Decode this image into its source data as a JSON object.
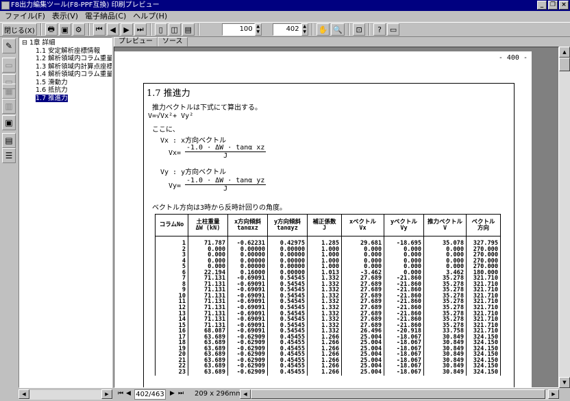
{
  "window": {
    "title": "F8出力編集ツール(F8-PPF互換) 印刷プレビュー"
  },
  "menu": [
    "ファイル(F)",
    "表示(V)",
    "電子納品(C)",
    "ヘルプ(H)"
  ],
  "toolbar": {
    "close_label": "閉じる(X)",
    "zoom_value": "100",
    "page_value": "402"
  },
  "tree": {
    "root": "1章 詳細",
    "items": [
      "1.1 安定解析座標情報",
      "1.2 解析領域内コラム重量",
      "1.3 解析領域内計算点座標",
      "1.4 解析領域内コラム重量",
      "1.5 滑動力",
      "1.6 抵抗力",
      "1.7 推進力"
    ],
    "selected_index": 6
  },
  "tabs": [
    "プレビュー",
    "ソース"
  ],
  "page": {
    "page_number": "- 400 -",
    "section_title": "1.7 推進力",
    "intro": "推力ベクトルは下式にて算出する。",
    "formula_v": "V=√Vx²+ Vy²",
    "here": "ここに、",
    "vx_label": "Vx : x方向ベクトル",
    "vx_eq": "Vx=",
    "vx_num": "-1.0 · ΔW · tanα xz",
    "vx_den": "J",
    "vy_label": "Vy : y方向ベクトル",
    "vy_eq": "Vy=",
    "vy_num": "-1.0 · ΔW · tanα yz",
    "vy_den": "J",
    "direction_note": "ベクトル方向は3時から反時計回りの角度。",
    "table": {
      "headers": [
        [
          "コラムNo",
          ""
        ],
        [
          "土柱重量",
          "ΔW (kN)"
        ],
        [
          "x方向傾斜",
          "tanαxz"
        ],
        [
          "y方向傾斜",
          "tanαyz"
        ],
        [
          "補正係数",
          "J"
        ],
        [
          "xベクトル",
          "Vx"
        ],
        [
          "yベクトル",
          "Vy"
        ],
        [
          "推力ベクトル",
          "V"
        ],
        [
          "ベクトル",
          "方向"
        ]
      ],
      "rows": [
        [
          "1",
          "71.787",
          "-0.62231",
          "0.42975",
          "1.285",
          "29.681",
          "-18.695",
          "35.078",
          "327.795"
        ],
        [
          "2",
          "0.000",
          "0.00000",
          "0.00000",
          "1.000",
          "0.000",
          "0.000",
          "0.000",
          "270.000"
        ],
        [
          "3",
          "0.000",
          "0.00000",
          "0.00000",
          "1.000",
          "0.000",
          "0.000",
          "0.000",
          "270.000"
        ],
        [
          "4",
          "0.000",
          "0.00000",
          "0.00000",
          "1.000",
          "0.000",
          "0.000",
          "0.000",
          "270.000"
        ],
        [
          "5",
          "0.000",
          "0.00000",
          "0.00000",
          "1.000",
          "0.000",
          "0.000",
          "0.000",
          "270.000"
        ],
        [
          "6",
          "22.194",
          "0.16000",
          "0.00000",
          "1.013",
          "-3.462",
          "0.000",
          "3.462",
          "180.000"
        ],
        [
          "7",
          "71.131",
          "-0.69091",
          "0.54545",
          "1.332",
          "27.689",
          "-21.860",
          "35.278",
          "321.710"
        ],
        [
          "8",
          "71.131",
          "-0.69091",
          "0.54545",
          "1.332",
          "27.689",
          "-21.860",
          "35.278",
          "321.710"
        ],
        [
          "9",
          "71.131",
          "-0.69091",
          "0.54545",
          "1.332",
          "27.689",
          "-21.860",
          "35.278",
          "321.710"
        ],
        [
          "10",
          "71.131",
          "-0.69091",
          "0.54545",
          "1.332",
          "27.689",
          "-21.860",
          "35.278",
          "321.710"
        ],
        [
          "11",
          "71.131",
          "-0.69091",
          "0.54545",
          "1.332",
          "27.689",
          "-21.860",
          "35.278",
          "321.710"
        ],
        [
          "12",
          "71.131",
          "-0.69091",
          "0.54545",
          "1.332",
          "27.689",
          "-21.860",
          "35.278",
          "321.710"
        ],
        [
          "13",
          "71.131",
          "-0.69091",
          "0.54545",
          "1.332",
          "27.689",
          "-21.860",
          "35.278",
          "321.710"
        ],
        [
          "14",
          "71.131",
          "-0.69091",
          "0.54545",
          "1.332",
          "27.689",
          "-21.860",
          "35.278",
          "321.710"
        ],
        [
          "15",
          "71.131",
          "-0.69091",
          "0.54545",
          "1.332",
          "27.689",
          "-21.860",
          "35.278",
          "321.710"
        ],
        [
          "16",
          "68.087",
          "-0.69091",
          "0.54545",
          "1.332",
          "26.496",
          "-20.918",
          "33.758",
          "321.710"
        ],
        [
          "17",
          "63.689",
          "-0.62909",
          "0.45455",
          "1.266",
          "25.004",
          "-18.067",
          "30.849",
          "324.150"
        ],
        [
          "18",
          "63.689",
          "-0.62909",
          "0.45455",
          "1.266",
          "25.004",
          "-18.067",
          "30.849",
          "324.150"
        ],
        [
          "19",
          "63.689",
          "-0.62909",
          "0.45455",
          "1.266",
          "25.004",
          "-18.067",
          "30.849",
          "324.150"
        ],
        [
          "20",
          "63.689",
          "-0.62909",
          "0.45455",
          "1.266",
          "25.004",
          "-18.067",
          "30.849",
          "324.150"
        ],
        [
          "21",
          "63.689",
          "-0.62909",
          "0.45455",
          "1.266",
          "25.004",
          "-18.067",
          "30.849",
          "324.150"
        ],
        [
          "22",
          "63.689",
          "-0.62909",
          "0.45455",
          "1.266",
          "25.004",
          "-18.067",
          "30.849",
          "324.150"
        ],
        [
          "23",
          "63.689",
          "-0.62909",
          "0.45455",
          "1.266",
          "25.004",
          "-18.067",
          "30.849",
          "324.150"
        ]
      ]
    }
  },
  "status": {
    "page_indicator": "402/463",
    "paper_size": "209 x 296mm"
  }
}
